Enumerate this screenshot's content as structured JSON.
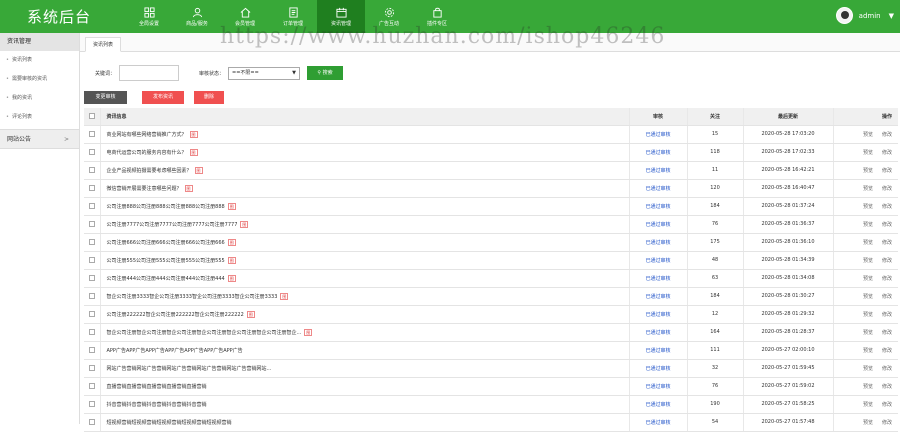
{
  "brand": "系统后台",
  "nav": [
    {
      "label": "全局设置",
      "icon": "grid-icon"
    },
    {
      "label": "商品/服务",
      "icon": "user-icon"
    },
    {
      "label": "会员管理",
      "icon": "home-icon"
    },
    {
      "label": "订单管理",
      "icon": "document-icon"
    },
    {
      "label": "资讯管理",
      "icon": "calendar-icon"
    },
    {
      "label": "广告互动",
      "icon": "gear-icon"
    },
    {
      "label": "插件专区",
      "icon": "shopping-bag-icon"
    }
  ],
  "nav_active": "资讯管理",
  "user": {
    "name": "admin"
  },
  "watermark": "https://www.huzhan.com/ishop46246",
  "sidebar": {
    "title": "资讯管理",
    "items": [
      {
        "label": "资讯列表"
      },
      {
        "label": "需要审核的资讯"
      },
      {
        "label": "我的资讯"
      },
      {
        "label": "评论列表"
      }
    ],
    "group": {
      "label": "网站公告"
    }
  },
  "tab": "资讯列表",
  "search": {
    "keyword_label": "关键词：",
    "keyword_value": "",
    "status_label": "审核状态：",
    "status_value": "==不限==",
    "button": "搜索"
  },
  "actions": {
    "review": "变更审核",
    "publish": "发布资讯",
    "delete": "删除"
  },
  "table": {
    "headers": {
      "title": "资讯信息",
      "status": "审核",
      "views": "关注",
      "date": "最后更新",
      "ops": "操作"
    },
    "op_preview": "预览",
    "op_edit": "修改",
    "rows": [
      {
        "title": "商业网站有哪些网络营销推广方式？",
        "tag": "图",
        "status": "已通过审核",
        "views": "15",
        "date": "2020-05-28 17:03:20"
      },
      {
        "title": "电商代运营公司的服务内容有什么？",
        "tag": "图",
        "status": "已通过审核",
        "views": "118",
        "date": "2020-05-28 17:02:33"
      },
      {
        "title": "企业产品视频拍摄需要考虑哪些因素？",
        "tag": "图",
        "status": "已通过审核",
        "views": "11",
        "date": "2020-05-28 16:42:21"
      },
      {
        "title": "微信营销开展需要注意哪些问题？",
        "tag": "图",
        "status": "已通过审核",
        "views": "120",
        "date": "2020-05-28 16:40:47"
      },
      {
        "title": "公司注册888公司注册888公司注册888公司注册888",
        "tag": "图",
        "status": "已通过审核",
        "views": "184",
        "date": "2020-05-28 01:37:24"
      },
      {
        "title": "公司注册7777公司注册7777公司注册7777公司注册7777",
        "tag": "图",
        "status": "已通过审核",
        "views": "76",
        "date": "2020-05-28 01:36:37"
      },
      {
        "title": "公司注册666公司注册666公司注册666公司注册666",
        "tag": "图",
        "status": "已通过审核",
        "views": "175",
        "date": "2020-05-28 01:36:10"
      },
      {
        "title": "公司注册555公司注册555公司注册555公司注册555",
        "tag": "图",
        "status": "已通过审核",
        "views": "48",
        "date": "2020-05-28 01:34:39"
      },
      {
        "title": "公司注册444公司注册444公司注册444公司注册444",
        "tag": "图",
        "status": "已通过审核",
        "views": "63",
        "date": "2020-05-28 01:34:08"
      },
      {
        "title": "智企公司注册3333智企公司注册3333智企公司注册3333智企公司注册3333",
        "tag": "图",
        "status": "已通过审核",
        "views": "184",
        "date": "2020-05-28 01:30:27"
      },
      {
        "title": "公司注册222222智企公司注册222222智企公司注册222222",
        "tag": "图",
        "status": "已通过审核",
        "views": "12",
        "date": "2020-05-28 01:29:32"
      },
      {
        "title": "智企公司注册智企公司注册智企公司注册智企公司注册智企公司注册智企公司注册智企...",
        "tag": "图",
        "status": "已通过审核",
        "views": "164",
        "date": "2020-05-28 01:28:37"
      },
      {
        "title": "APP广告APP广告APP广告APP广告APP广告APP广告APP广告",
        "tag": "",
        "status": "已通过审核",
        "views": "111",
        "date": "2020-05-27 02:00:10"
      },
      {
        "title": "网站广告营销网站广告营销网站广告营销网站广告营销网站广告营销网站...",
        "tag": "",
        "status": "已通过审核",
        "views": "32",
        "date": "2020-05-27 01:59:45"
      },
      {
        "title": "直播营销直播营销直播营销直播营销直播营销",
        "tag": "",
        "status": "已通过审核",
        "views": "76",
        "date": "2020-05-27 01:59:02"
      },
      {
        "title": "抖音营销抖音营销抖音营销抖音营销抖音营销",
        "tag": "",
        "status": "已通过审核",
        "views": "190",
        "date": "2020-05-27 01:58:25"
      },
      {
        "title": "短视频营销短视频营销短视频营销短视频营销短视频营销",
        "tag": "",
        "status": "已通过审核",
        "views": "54",
        "date": "2020-05-27 01:57:48"
      }
    ]
  }
}
